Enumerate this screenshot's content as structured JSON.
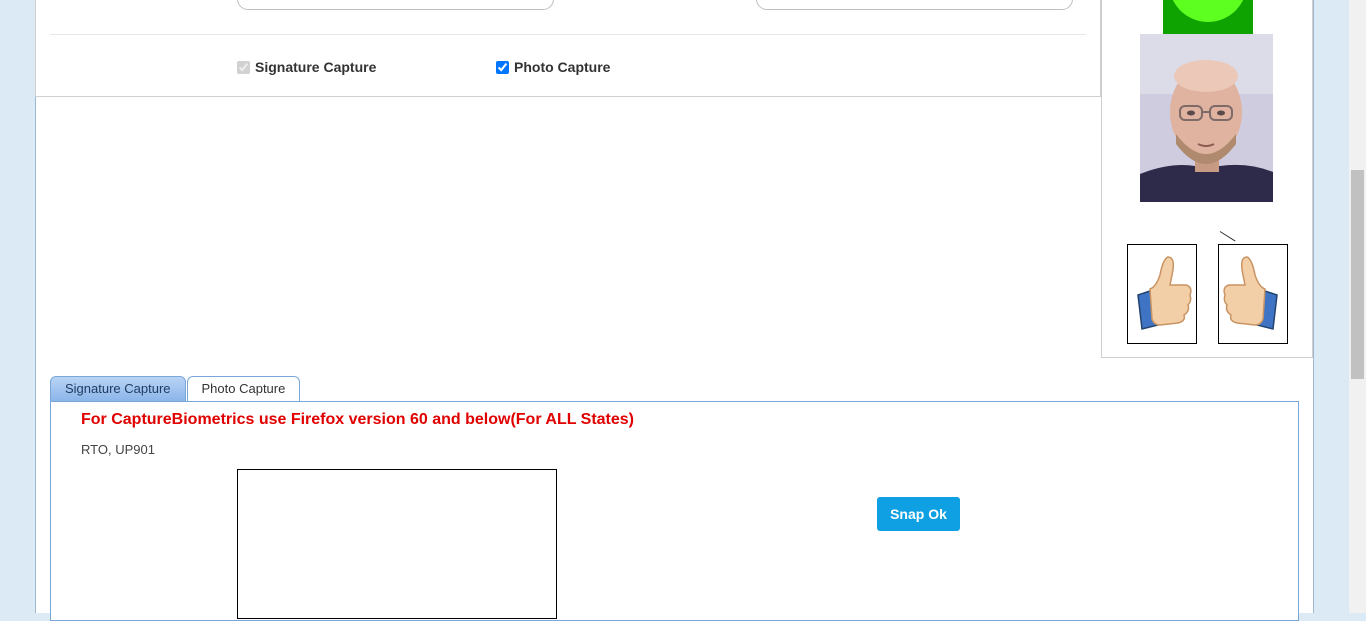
{
  "options": {
    "signature_capture": {
      "label": "Signature Capture",
      "checked": true,
      "disabled": true
    },
    "photo_capture": {
      "label": "Photo Capture",
      "checked": true
    }
  },
  "tabs": [
    {
      "label": "Signature Capture",
      "active": false
    },
    {
      "label": "Photo Capture",
      "active": true
    }
  ],
  "notice": {
    "warning": "For CaptureBiometrics use Firefox version 60 and below(For ALL States)",
    "office": "RTO, UP901"
  },
  "actions": {
    "snap_ok": "Snap Ok"
  },
  "colors": {
    "accent": "#0fa0e3",
    "warning": "#e00000",
    "status_green": "#5cff1f",
    "tab_border": "#79a7d8"
  },
  "icons": [
    "thumbs-up-icon",
    "thumbs-up-icon"
  ]
}
